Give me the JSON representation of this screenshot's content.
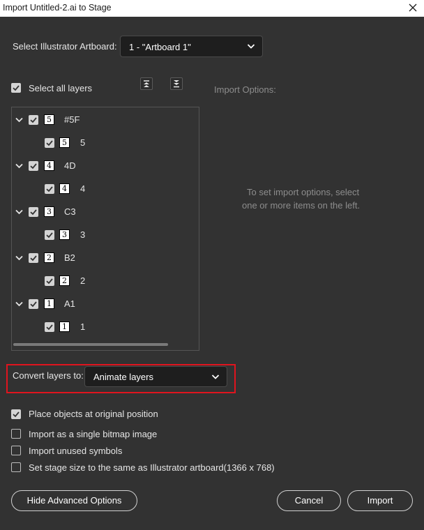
{
  "window": {
    "title": "Import Untitled-2.ai to Stage"
  },
  "artboard": {
    "label": "Select Illustrator Artboard:",
    "value": "1 - \"Artboard 1\""
  },
  "select_all": {
    "label": "Select all layers",
    "checked": true
  },
  "import_options": {
    "title": "Import Options:",
    "hint_line1": "To set import options, select",
    "hint_line2": "one or more items on the left."
  },
  "layers": [
    {
      "name": "#5F",
      "thumb": "5",
      "child": {
        "name": "5",
        "thumb": "5"
      }
    },
    {
      "name": "4D",
      "thumb": "4",
      "child": {
        "name": "4",
        "thumb": "4"
      }
    },
    {
      "name": "C3",
      "thumb": "3",
      "child": {
        "name": "3",
        "thumb": "3"
      }
    },
    {
      "name": "B2",
      "thumb": "2",
      "child": {
        "name": "2",
        "thumb": "2"
      }
    },
    {
      "name": "A1",
      "thumb": "1",
      "child": {
        "name": "1",
        "thumb": "1"
      }
    }
  ],
  "convert": {
    "label": "Convert layers to:",
    "value": "Animate layers"
  },
  "options": [
    {
      "label": "Place objects at original position",
      "checked": true
    },
    {
      "label": "Import as a single bitmap image",
      "checked": false
    },
    {
      "label": "Import unused symbols",
      "checked": false
    },
    {
      "label": "Set stage size to the same as Illustrator artboard(1366 x 768)",
      "checked": false
    }
  ],
  "buttons": {
    "advanced": "Hide Advanced Options",
    "cancel": "Cancel",
    "import": "Import"
  },
  "colors": {
    "background": "#323232",
    "field": "#1e1e1e",
    "highlight": "#e0141e",
    "text": "#e6e6e6"
  },
  "icons": {
    "close": "close-icon",
    "chevron": "chevron-down-icon",
    "check": "checkmark-icon",
    "move_top": "move-to-top-icon",
    "move_bottom": "move-to-bottom-icon"
  }
}
